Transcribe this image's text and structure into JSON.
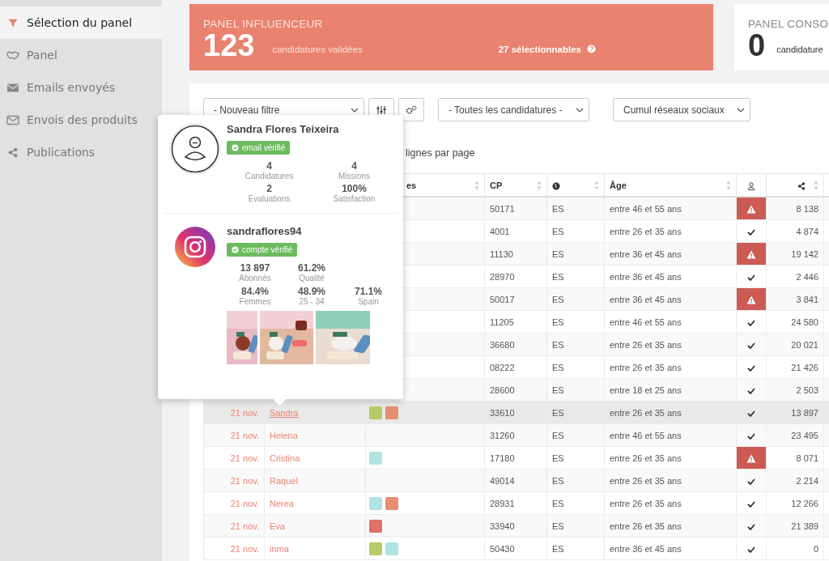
{
  "sidebar": {
    "items": [
      {
        "label": "Sélection du panel",
        "selected": true
      },
      {
        "label": "Panel",
        "selected": false
      },
      {
        "label": "Emails envoyés",
        "selected": false
      },
      {
        "label": "Envois des produits",
        "selected": false
      },
      {
        "label": "Publications",
        "selected": false
      }
    ]
  },
  "cards": [
    {
      "kind": "highlight",
      "title": "PANEL INFLUENCEUR",
      "count": "123",
      "caption": "candidatures validées",
      "extra": "27 sélectionnables"
    },
    {
      "kind": "plain",
      "title": "PANEL CONSO",
      "count": "0",
      "caption": "candidature"
    }
  ],
  "filters": {
    "new_filter": "- Nouveau filtre",
    "applications": "- Toutes les candidatures -",
    "networks": "Cumul réseaux sociaux"
  },
  "rows_per_page_label": "lignes par page",
  "table": {
    "columns": [
      {
        "label": "es",
        "sortable": true
      },
      {
        "label": "CP",
        "sortable": true
      },
      {
        "sortable": true
      },
      {
        "label": "Âge",
        "sortable": true
      },
      {
        "sortable": false
      },
      {
        "sortable": true
      }
    ],
    "rows": [
      {
        "cp": "50171",
        "country": "ES",
        "age": "entre 46 et 55 ans",
        "kind": "warning",
        "shares": "8 138",
        "hovered": false,
        "tags": []
      },
      {
        "cp": "4001",
        "country": "ES",
        "age": "entre 26 et 35 ans",
        "kind": "ok",
        "shares": "4 874",
        "hovered": false,
        "tags": []
      },
      {
        "cp": "11130",
        "country": "ES",
        "age": "entre 36 et 45 ans",
        "kind": "warning",
        "shares": "19 142",
        "hovered": false,
        "tags": []
      },
      {
        "cp": "28970",
        "country": "ES",
        "age": "entre 36 et 45 ans",
        "kind": "ok",
        "shares": "2 446",
        "hovered": false,
        "tags": []
      },
      {
        "cp": "50017",
        "country": "ES",
        "age": "entre 36 et 45 ans",
        "kind": "warning",
        "shares": "3 841",
        "hovered": false,
        "tags": []
      },
      {
        "cp": "11205",
        "country": "ES",
        "age": "entre 46 et 55 ans",
        "kind": "ok",
        "shares": "24 580",
        "hovered": false,
        "tags": []
      },
      {
        "cp": "36680",
        "country": "ES",
        "age": "entre 26 et 35 ans",
        "kind": "ok",
        "shares": "20 021",
        "hovered": false,
        "tags": []
      },
      {
        "cp": "08222",
        "country": "ES",
        "age": "entre 26 et 35 ans",
        "kind": "ok",
        "shares": "21 426",
        "hovered": false,
        "tags": []
      },
      {
        "cp": "28600",
        "country": "ES",
        "age": "entre 18 et 25 ans",
        "kind": "ok",
        "shares": "2 503",
        "hovered": false,
        "tags": []
      },
      {
        "date": "21 nov.",
        "name": "Sandra",
        "cp": "33610",
        "country": "ES",
        "age": "entre 26 et 35 ans",
        "kind": "ok",
        "shares": "13 897",
        "hovered": true,
        "tags": [
          {
            "color": "#b5cc68"
          },
          {
            "color": "#e58e73"
          }
        ]
      },
      {
        "date": "21 nov.",
        "name": "Helena",
        "cp": "31260",
        "country": "ES",
        "age": "entre 46 et 55 ans",
        "kind": "ok",
        "shares": "23 495",
        "hovered": false,
        "tags": []
      },
      {
        "date": "21 nov.",
        "name": "Cristina",
        "cp": "17180",
        "country": "ES",
        "age": "entre 26 et 35 ans",
        "kind": "warning",
        "shares": "8 071",
        "hovered": false,
        "tags": [
          {
            "color": "#aee4e2"
          }
        ]
      },
      {
        "date": "21 nov.",
        "name": "Raquel",
        "cp": "49014",
        "country": "ES",
        "age": "entre 26 et 35 ans",
        "kind": "ok",
        "shares": "2 214",
        "hovered": false,
        "tags": []
      },
      {
        "date": "21 nov.",
        "name": "Nerea",
        "cp": "28931",
        "country": "ES",
        "age": "entre 26 et 35 ans",
        "kind": "ok",
        "shares": "12 266",
        "hovered": false,
        "tags": [
          {
            "color": "#aee4e2"
          },
          {
            "color": "#e58e73"
          }
        ]
      },
      {
        "date": "21 nov.",
        "name": "Eva",
        "cp": "33940",
        "country": "ES",
        "age": "entre 26 et 35 ans",
        "kind": "ok",
        "shares": "21 389",
        "hovered": false,
        "tags": [
          {
            "color": "#e0706a"
          }
        ]
      },
      {
        "date": "21 nov.",
        "name": "inma",
        "cp": "50430",
        "country": "ES",
        "age": "entre 36 et 45 ans",
        "kind": "ok",
        "shares": "0",
        "hovered": false,
        "tags": [
          {
            "color": "#b5cc68"
          },
          {
            "color": "#aee4e2"
          }
        ]
      }
    ]
  },
  "popover": {
    "name": "Sandra Flores Teixeira",
    "email_badge": "email vérifié",
    "user_stats": [
      {
        "value": "4",
        "label": "Candidatures"
      },
      {
        "value": "4",
        "label": "Missions"
      },
      {
        "value": "2",
        "label": "Evaluations"
      },
      {
        "value": "100%",
        "label": "Satisfaction"
      }
    ],
    "handle": "sandraflores94",
    "account_badge": "compte vérifié",
    "account_stats": [
      {
        "value": "13 897",
        "label": "Abonnés"
      },
      {
        "value": "61.2%",
        "label": "Qualité"
      },
      {
        "value": "84.4%",
        "label": "Femmes"
      },
      {
        "value": "48.9%",
        "label": "25 - 34"
      },
      {
        "value": "71.1%",
        "label": "Spain"
      }
    ]
  }
}
